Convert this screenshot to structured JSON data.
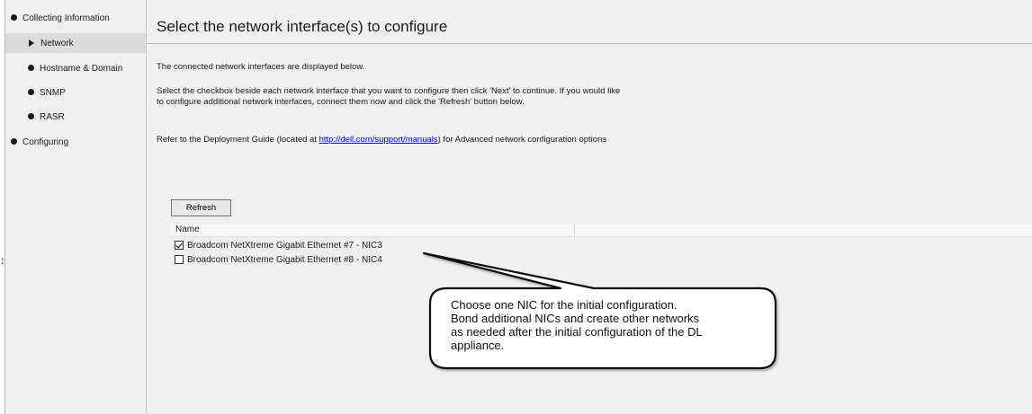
{
  "sidebar": {
    "items": [
      {
        "label": "Collecting Information",
        "marker": "bullet"
      },
      {
        "label": "Network",
        "marker": "arrow",
        "selected": true
      },
      {
        "label": "Hostname & Domain",
        "marker": "bullet"
      },
      {
        "label": "SNMP",
        "marker": "bullet"
      },
      {
        "label": "RASR",
        "marker": "bullet"
      },
      {
        "label": "Configuring",
        "marker": "bullet"
      }
    ]
  },
  "main": {
    "title": "Select the network interface(s) to configure",
    "intro": "The connected network interfaces are displayed below.",
    "instructions": "Select the checkbox beside each network interface that you want to configure then click 'Next' to continue. If you would like to configure additional network interfaces, connect them now and click the 'Refresh' button below.",
    "guide_prefix": "Refer to the Deployment Guide (located at ",
    "guide_link": "http://dell.com/support/manuals",
    "guide_suffix": ") for Advanced network configuration options",
    "refresh_label": "Refresh",
    "grid": {
      "column_name": "Name",
      "rows": [
        {
          "label": "Broadcom NetXtreme Gigabit Ethernet #7 -  NIC3",
          "checked": true
        },
        {
          "label": "Broadcom NetXtreme Gigabit Ethernet #8 -  NIC4",
          "checked": false
        }
      ]
    }
  },
  "callout": {
    "line1": "Choose one NIC for the initial configuration.",
    "line2": "Bond additional NICs and create other networks",
    "line3": "as needed after the initial configuration of the DL",
    "line4": "appliance."
  }
}
